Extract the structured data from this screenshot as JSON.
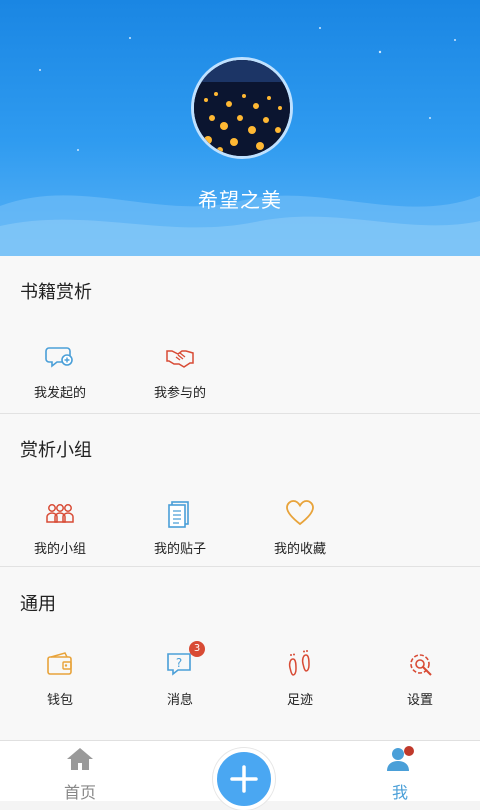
{
  "profile": {
    "username": "希望之美"
  },
  "sections": [
    {
      "title": "书籍赏析",
      "items": [
        {
          "label": "我发起的"
        },
        {
          "label": "我参与的"
        }
      ]
    },
    {
      "title": "赏析小组",
      "items": [
        {
          "label": "我的小组"
        },
        {
          "label": "我的贴子"
        },
        {
          "label": "我的收藏"
        }
      ]
    },
    {
      "title": "通用",
      "items": [
        {
          "label": "钱包"
        },
        {
          "label": "消息",
          "badge": "3"
        },
        {
          "label": "足迹"
        },
        {
          "label": "设置"
        }
      ]
    }
  ],
  "tabbar": {
    "home": "首页",
    "me": "我",
    "add": "+"
  },
  "colors": {
    "accent": "#2f9bf0",
    "orange": "#e8a33a",
    "red": "#d84b35",
    "blue_icon": "#4a9fd8"
  },
  "icons": [
    "chat-add-icon",
    "handshake-icon",
    "group-icon",
    "document-icon",
    "heart-icon",
    "wallet-icon",
    "message-icon",
    "footprint-icon",
    "settings-icon",
    "home-icon",
    "add-icon",
    "user-icon"
  ]
}
